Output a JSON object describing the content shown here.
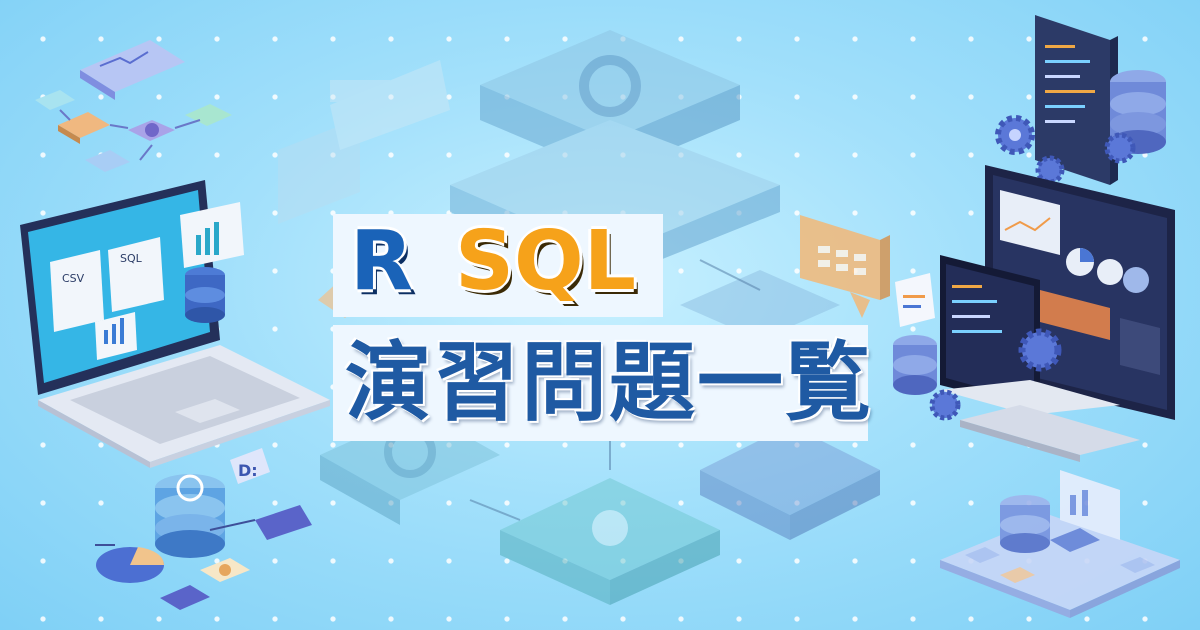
{
  "banner": {
    "title_r": "R",
    "title_sql": "SQL",
    "subtitle": "演習問題一覧"
  },
  "illustrations": {
    "laptop_labels": {
      "csv": "CSV",
      "sql": "SQL"
    },
    "db_badge": "D:"
  },
  "colors": {
    "background": "#a2e0fb",
    "r_blue": "#1a63b8",
    "sql_orange": "#f6a21a",
    "subtitle_blue": "#1f5aa3",
    "title_box": "#eef7ff"
  }
}
